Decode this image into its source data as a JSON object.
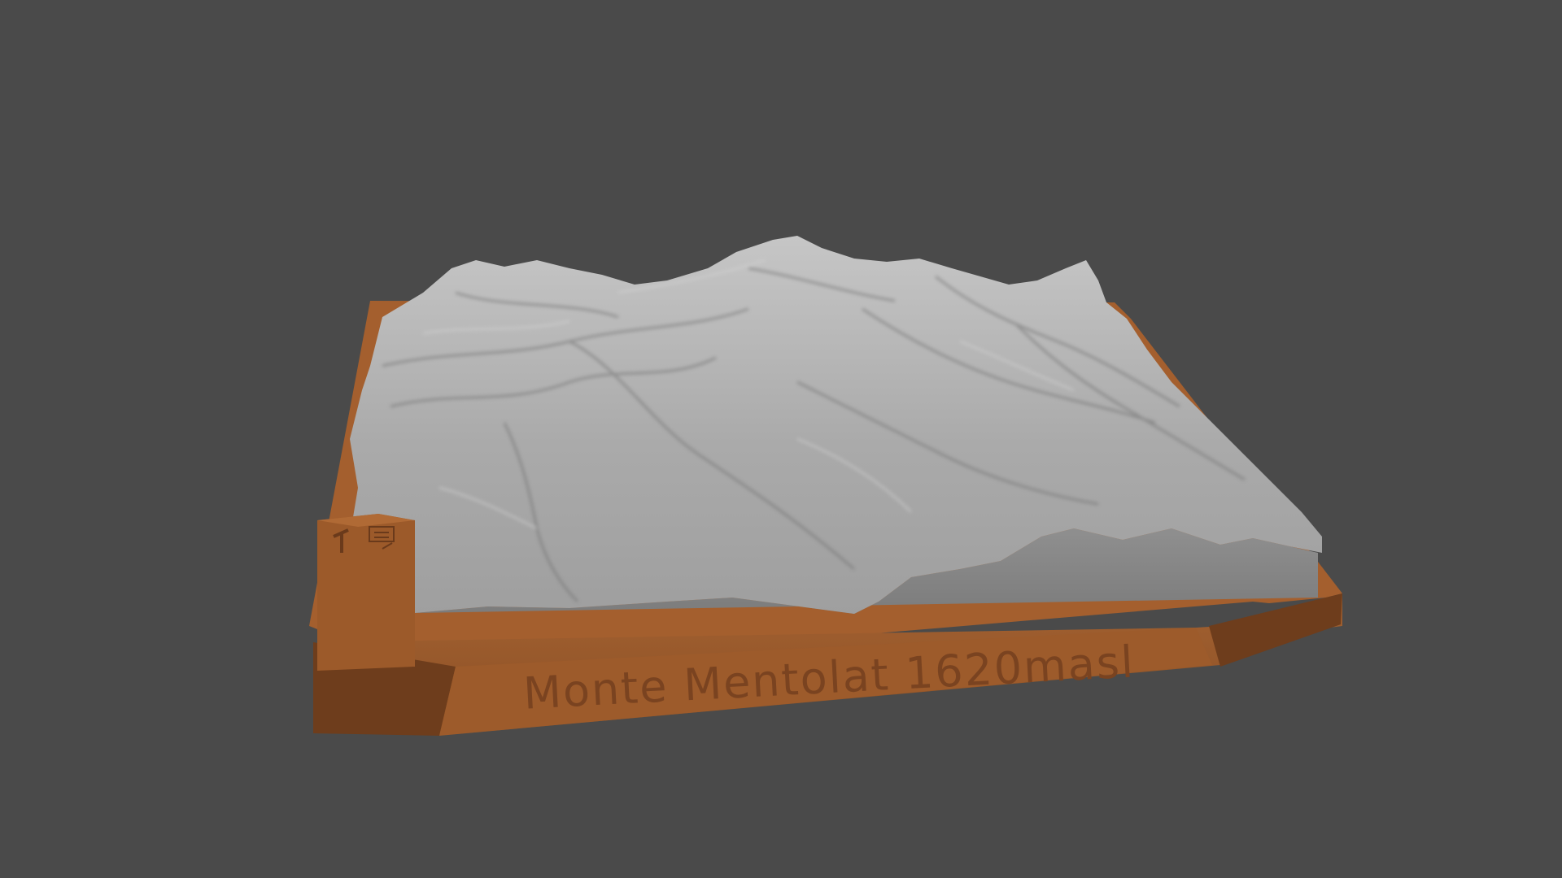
{
  "scene": {
    "plaque_text": "Monte Mentolat 1620masl",
    "colors": {
      "background": "#4a4a4a",
      "base_front": "#9a5a2c",
      "base_top": "#a35e2d",
      "base_shadow": "#6a3a1b",
      "base_side": "#80471f",
      "terrain_light": "#b9b9b9",
      "terrain_mid": "#9d9d9d",
      "terrain_dark": "#747474",
      "terrain_side": "#8a8a8a"
    },
    "icons": [
      "hiker-icon",
      "compass-icon"
    ]
  }
}
